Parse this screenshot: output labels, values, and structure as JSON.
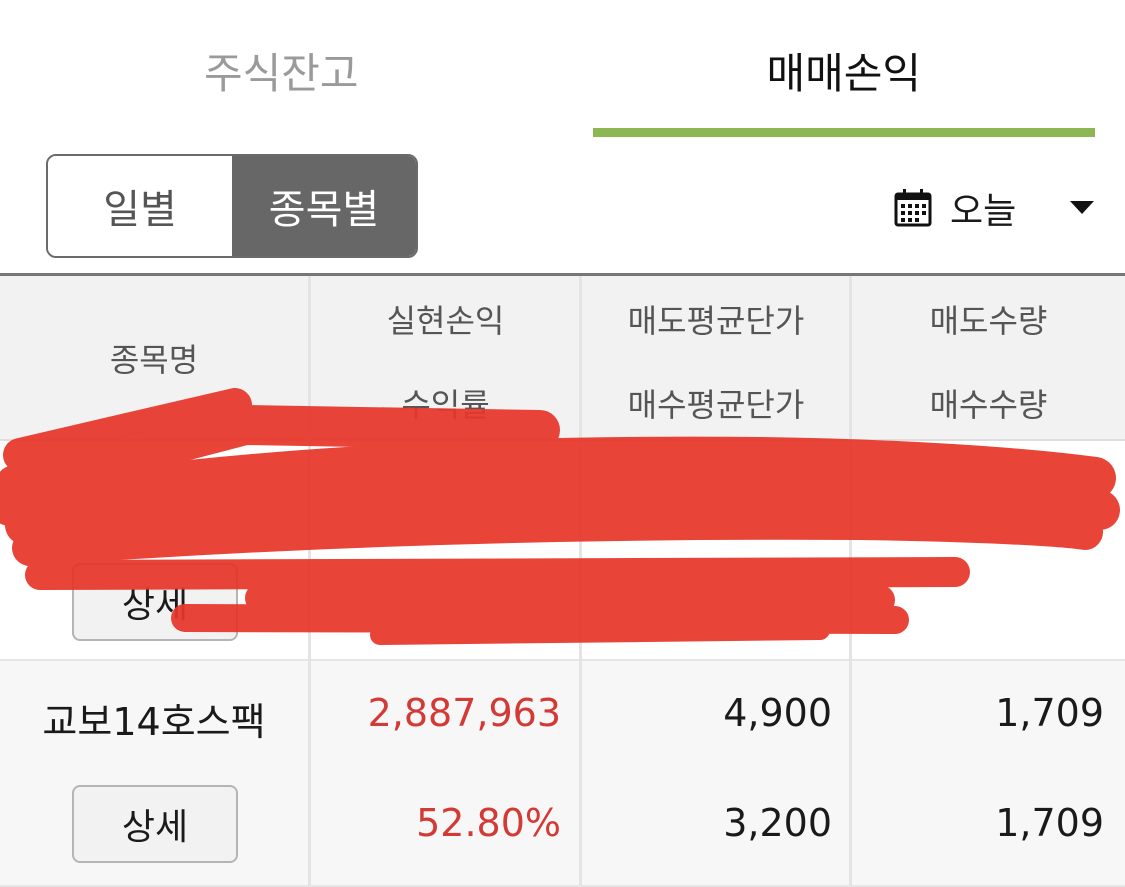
{
  "tabs": [
    {
      "label": "주식잔고",
      "active": false
    },
    {
      "label": "매매손익",
      "active": true
    }
  ],
  "segment": {
    "daily_label": "일별",
    "by_stock_label": "종목별",
    "selected": "종목별"
  },
  "date_select": {
    "icon": "calendar-icon",
    "value": "오늘"
  },
  "table": {
    "headers": {
      "name": "종목명",
      "realized_pl": "실현손익",
      "return_rate": "수익률",
      "avg_sell_price": "매도평균단가",
      "avg_buy_price": "매수평균단가",
      "sell_qty": "매도수량",
      "buy_qty": "매수수량"
    },
    "rows": [
      {
        "name": "",
        "detail_label": "상세",
        "redacted": true
      },
      {
        "name": "교보14호스팩",
        "detail_label": "상세",
        "realized_pl": "2,887,963",
        "return_rate": "52.80%",
        "avg_sell_price": "4,900",
        "avg_buy_price": "3,200",
        "sell_qty": "1,709",
        "buy_qty": "1,709",
        "redacted": false
      }
    ]
  },
  "colors": {
    "accent_green": "#8db752",
    "profit_red": "#d33a35",
    "segment_selected": "#676767",
    "redaction_red": "#e8362a"
  }
}
